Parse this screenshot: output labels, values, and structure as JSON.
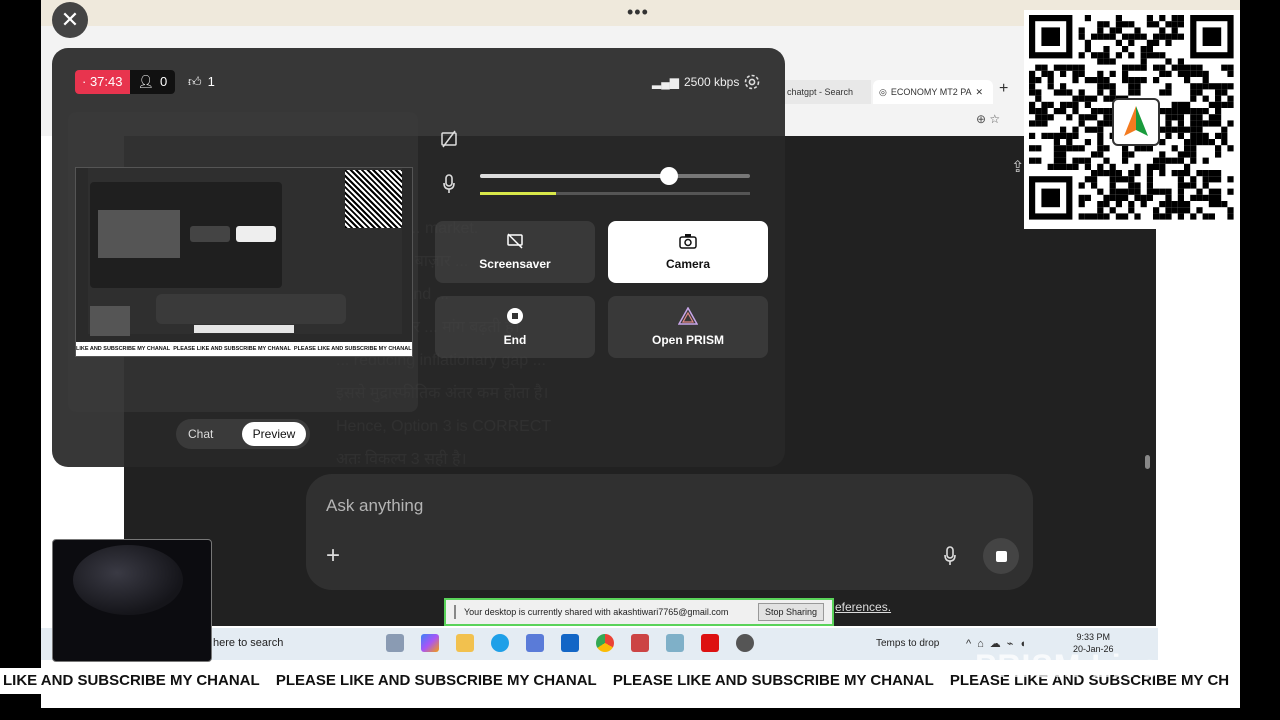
{
  "close_button": {
    "icon": "close-icon"
  },
  "stream": {
    "timer": "37:43",
    "viewers": "0",
    "likes": "1",
    "bitrate": "2500 kbps",
    "live_color": "#e8344e"
  },
  "audio": {
    "mic_volume_fraction": 0.7,
    "mic_level_fraction": 0.28
  },
  "controls": {
    "screensaver": "Screensaver",
    "camera": "Camera",
    "end": "End",
    "open_prism": "Open PRISM"
  },
  "toggle": {
    "chat": "Chat",
    "preview": "Preview"
  },
  "browser": {
    "tab_search": "chatgpt - Search",
    "tab_economy": "ECONOMY MT2 PA"
  },
  "app": {
    "ask_placeholder": "Ask anything",
    "text_lines": [
      "related to ... market.",
      "... आपूर्ति ... बाज़ार ...",
      "... supply and ... ",
      "... आपूर्ति और ... मांग बढ़ती है।",
      "... reducing inflationary gap ...",
      "इससे मुद्रास्फीतिक अंतर कम होता है।",
      "Hence, Option 3 is CORRECT",
      "अतः विकल्प 3 सही है।"
    ],
    "references_link": "eferences."
  },
  "share_bar": {
    "text": "Your desktop is currently shared with akashtiwari7765@gmail.com",
    "stop_label": "Stop Sharing"
  },
  "taskbar": {
    "search_text": "here to search",
    "weather": "Temps to drop",
    "time": "9:33 PM",
    "date": "20-Jan-26"
  },
  "ticker": {
    "message": "PLEASE LIKE AND SUBSCRIBE MY CHANAL",
    "first_fragment": "LIKE AND SUBSCRIBE MY CHANAL",
    "last_fragment": "PLEASE LIKE AND SUBSCRIBE MY CH"
  },
  "watermark": "PRISM Live"
}
